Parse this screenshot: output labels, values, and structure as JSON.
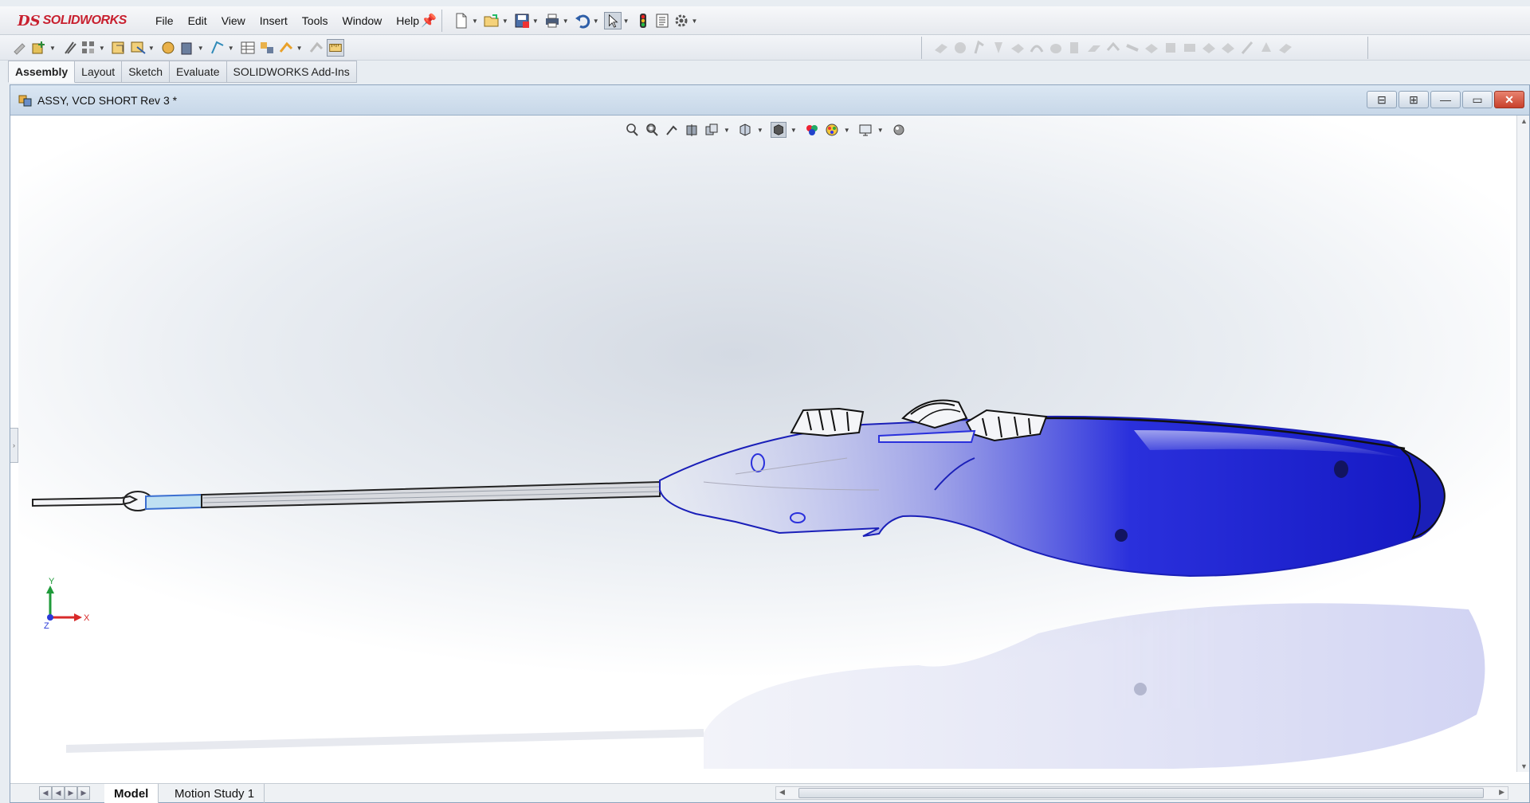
{
  "app": {
    "logo_prefix": "DS",
    "logo_text": "SOLIDWORKS"
  },
  "menu": {
    "items": [
      "File",
      "Edit",
      "View",
      "Insert",
      "Tools",
      "Window",
      "Help"
    ]
  },
  "command_tabs": [
    {
      "label": "Assembly",
      "active": true
    },
    {
      "label": "Layout",
      "active": false
    },
    {
      "label": "Sketch",
      "active": false
    },
    {
      "label": "Evaluate",
      "active": false
    },
    {
      "label": "SOLIDWORKS Add-Ins",
      "active": false
    }
  ],
  "document": {
    "title": "ASSY, VCD SHORT Rev 3 *"
  },
  "triad": {
    "x_label": "X",
    "y_label": "Y",
    "z_label": "Z"
  },
  "bottom_tabs": [
    {
      "label": "Model",
      "active": true
    },
    {
      "label": "Motion Study 1",
      "active": false
    }
  ],
  "colors": {
    "model_blue": "#1a1fd6",
    "brand_red": "#c8202f",
    "close_red": "#c8402b"
  },
  "icons": {
    "standard_toolbar": [
      "new-document-icon",
      "open-icon",
      "save-icon",
      "print-icon",
      "undo-icon",
      "select-icon",
      "rebuild-icon",
      "file-properties-icon",
      "options-icon"
    ],
    "heads_up_view": [
      "zoom-to-fit-icon",
      "zoom-to-area-icon",
      "previous-view-icon",
      "section-view-icon",
      "view-orientation-icon",
      "display-style-icon",
      "hide-show-items-icon",
      "edit-appearance-icon",
      "apply-scene-icon",
      "view-settings-icon"
    ]
  }
}
